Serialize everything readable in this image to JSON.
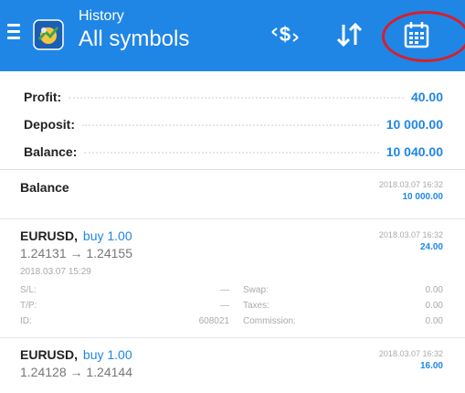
{
  "header": {
    "subtitle": "History",
    "title": "All symbols",
    "icons": [
      "menu-icon",
      "app-logo",
      "currency-filter-icon",
      "sort-icon",
      "calendar-icon"
    ],
    "accent": "#1f86e6",
    "highlight_color": "#d5202c"
  },
  "summary": {
    "profit_label": "Profit:",
    "profit_value": "40.00",
    "deposit_label": "Deposit:",
    "deposit_value": "10 000.00",
    "balance_label": "Balance:",
    "balance_value": "10 040.00"
  },
  "entries": [
    {
      "title": "Balance",
      "date": "2018.03.07 16:32",
      "amount": "10 000.00"
    },
    {
      "symbol": "EURUSD,",
      "side": "buy 1.00",
      "prices": "1.24131 → 1.24155",
      "open_time": "2018.03.07 15:29",
      "date": "2018.03.07 16:32",
      "amount": "24.00",
      "sl_label": "S/L:",
      "sl_value": "—",
      "tp_label": "T/P:",
      "tp_value": "—",
      "id_label": "ID:",
      "id_value": "608021",
      "swap_label": "Swap:",
      "swap_value": "0.00",
      "taxes_label": "Taxes:",
      "taxes_value": "0.00",
      "commission_label": "Commission:",
      "commission_value": "0.00"
    },
    {
      "symbol": "EURUSD,",
      "side": "buy 1.00",
      "prices": "1.24128 → 1.24144",
      "date": "2018.03.07 16:32",
      "amount": "16.00"
    }
  ]
}
